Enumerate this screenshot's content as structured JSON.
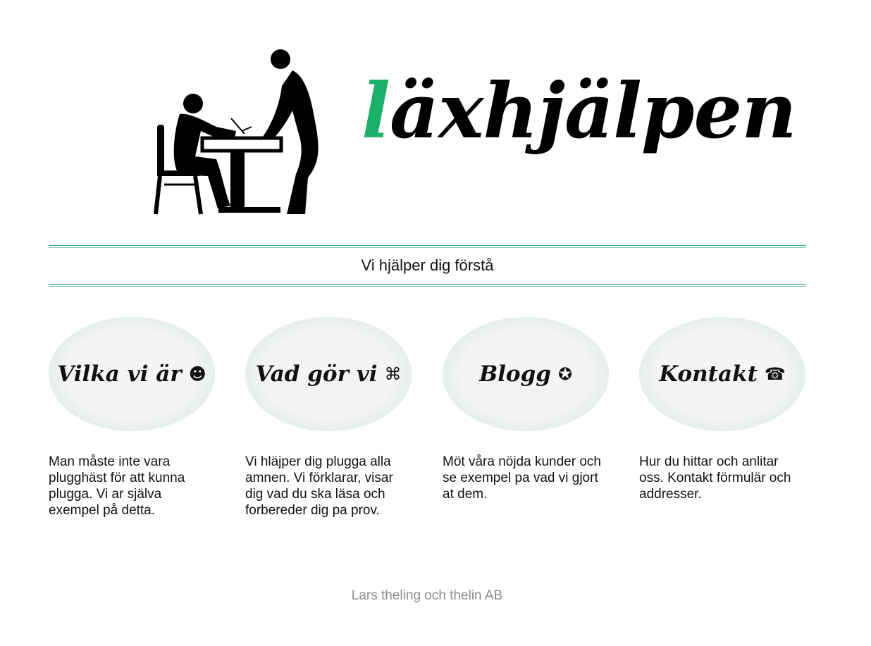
{
  "logo": {
    "first_letter": "l",
    "rest": "äxhjälpen",
    "accent_color": "#1db068",
    "illustration_icon": "student-and-teacher-at-desk-icon"
  },
  "tagline": "Vi hjälper dig förstå",
  "cards": [
    {
      "label": "Vilka vi är",
      "icon": "☻",
      "icon_name": "face-icon",
      "text": "Man måste inte vara plugghäst för att kunna plugga. Vi ar själva exempel på detta."
    },
    {
      "label": "Vad gör vi",
      "icon": "⌘",
      "icon_name": "command-icon",
      "text": "Vi hläjper dig plugga alla amnen. Vi förklarar, visar dig vad du ska läsa och forbereder dig pa prov."
    },
    {
      "label": "Blogg",
      "icon": "✪",
      "icon_name": "star-circle-icon",
      "text": "Möt våra nöjda kunder och se exempel pa vad vi gjort at dem."
    },
    {
      "label": "Kontakt",
      "icon": "☎",
      "icon_name": "telephone-icon",
      "text": "Hur du hittar och anlitar oss. Kontakt förmulär och addresser."
    }
  ],
  "footer": "Lars theling och thelin AB",
  "colors": {
    "rule": "#3aa57d",
    "bubble_edge": "#6daf91",
    "footer_text": "#8c8c8c"
  }
}
